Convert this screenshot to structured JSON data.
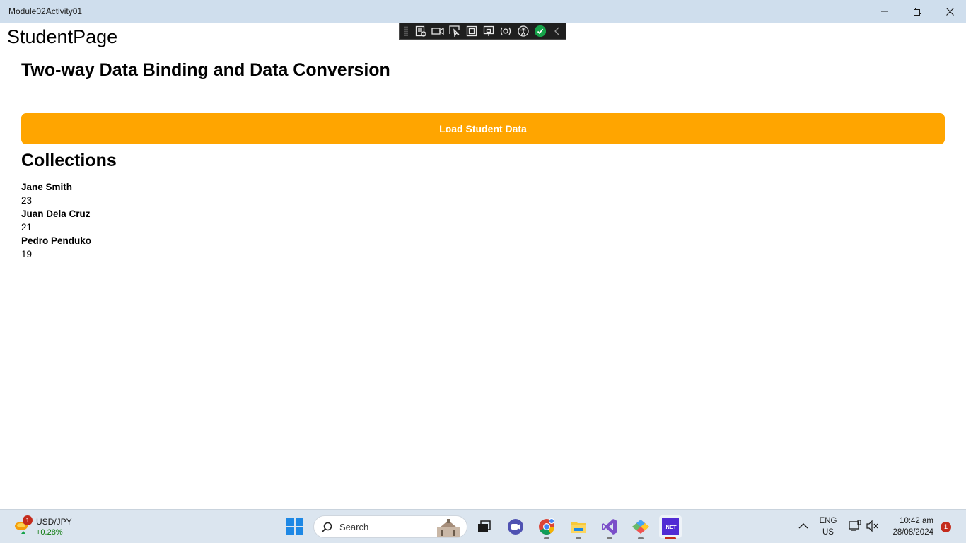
{
  "window": {
    "title": "Module02Activity01",
    "minimize_icon": "minimize-icon",
    "maximize_icon": "restore-icon",
    "close_icon": "close-icon"
  },
  "page": {
    "header": "StudentPage",
    "heading": "Two-way Data Binding and Data Conversion",
    "load_button_label": "Load Student Data",
    "collections_heading": "Collections",
    "accent_color": "#ffa500"
  },
  "students": [
    {
      "name": "Jane Smith",
      "age": "23"
    },
    {
      "name": "Juan Dela Cruz",
      "age": "21"
    },
    {
      "name": "Pedro Penduko",
      "age": "19"
    }
  ],
  "dev_toolbar": {
    "tools": [
      "live-visual-tree-icon",
      "record-icon",
      "select-element-icon",
      "display-layout-adorners-icon",
      "track-focus-icon",
      "binding-failures-icon",
      "accessibility-icon",
      "hot-reload-ok-icon",
      "collapse-icon"
    ]
  },
  "taskbar": {
    "widget": {
      "pair": "USD/JPY",
      "change": "+0.28%",
      "badge": "1"
    },
    "search_placeholder": "Search",
    "apps": [
      "task-view-icon",
      "teams-icon",
      "chrome-icon",
      "file-explorer-icon",
      "visual-studio-icon",
      "app-icon",
      "dotnet-app-icon"
    ],
    "dotnet_label": ".NET",
    "language": {
      "line1": "ENG",
      "line2": "US"
    },
    "time": "10:42 am",
    "date": "28/08/2024",
    "notification_count": "1"
  }
}
